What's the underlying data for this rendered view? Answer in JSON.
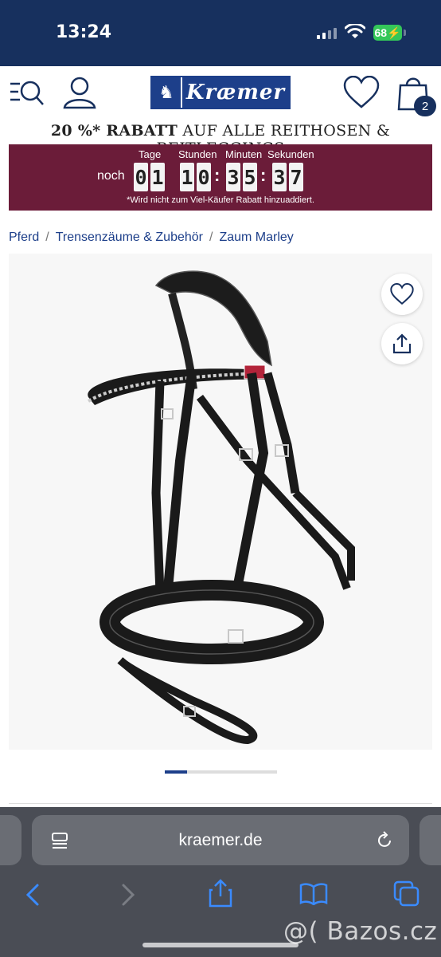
{
  "status_bar": {
    "time": "13:24",
    "battery": "68"
  },
  "header": {
    "logo_text": "Kræmer",
    "cart_count": "2"
  },
  "promo": {
    "title_bold": "20 %* RABATT",
    "title_rest": " AUF ALLE REITHOSEN & REITLEGGINGS",
    "countdown": {
      "prefix": "noch",
      "labels": [
        "Tage",
        "Stunden",
        "Minuten",
        "Sekunden"
      ],
      "days": [
        "0",
        "1"
      ],
      "hours": [
        "1",
        "0"
      ],
      "minutes": [
        "3",
        "5"
      ],
      "seconds": [
        "3",
        "7"
      ],
      "note": "*Wird nicht zum Viel-Käufer Rabatt hinzuaddiert."
    }
  },
  "breadcrumb": {
    "items": [
      "Pferd",
      "Trensenzäume & Zubehör",
      "Zaum Marley"
    ]
  },
  "carousel": {
    "current": 1,
    "progress": 0.2
  },
  "browser": {
    "url": "kraemer.de"
  },
  "watermark": "@( Bazos.cz",
  "colors": {
    "brand_blue": "#17305e",
    "promo_bg": "#6b1c39",
    "link_blue": "#1d3f8a",
    "battery_green": "#34c759"
  }
}
